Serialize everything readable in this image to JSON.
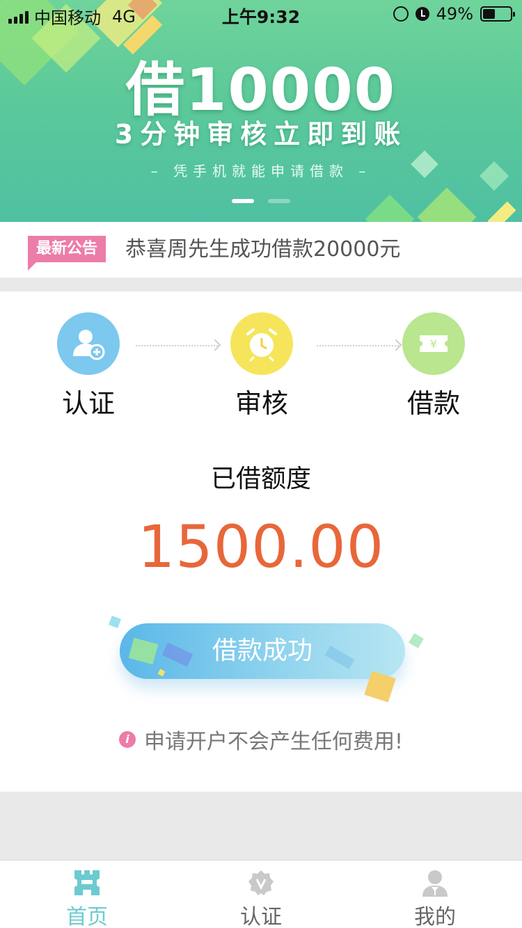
{
  "status_bar": {
    "carrier": "中国移动",
    "network": "4G",
    "time": "上午9:32",
    "battery_percent": "49%",
    "battery_level": 0.49
  },
  "banner": {
    "headline": "借10000",
    "subheadline": "3分钟审核立即到账",
    "tagline": "– 凭手机就能申请借款 –",
    "slide_count": 2,
    "active_slide": 0
  },
  "notice": {
    "badge": "最新公告",
    "text": "恭喜周先生成功借款20000元"
  },
  "steps": [
    {
      "label": "认证",
      "icon": "user-add-icon",
      "color": "#7cc8ee"
    },
    {
      "label": "审核",
      "icon": "alarm-clock-icon",
      "color": "#f6e55a"
    },
    {
      "label": "借款",
      "icon": "yen-ticket-icon",
      "color": "#b9e68e"
    }
  ],
  "quota": {
    "label": "已借额度",
    "value": "1500.00"
  },
  "loan_button": {
    "label": "借款成功"
  },
  "tip": {
    "text": "申请开户不会产生任何费用!"
  },
  "tabs": [
    {
      "label": "首页",
      "icon": "home-icon",
      "active": true
    },
    {
      "label": "认证",
      "icon": "verified-badge-icon",
      "active": false
    },
    {
      "label": "我的",
      "icon": "profile-icon",
      "active": false
    }
  ],
  "colors": {
    "accent": "#6ccbd0",
    "amount": "#e8673a",
    "notice_badge": "#ec7ca8",
    "banner_green": "#5cc99a"
  }
}
